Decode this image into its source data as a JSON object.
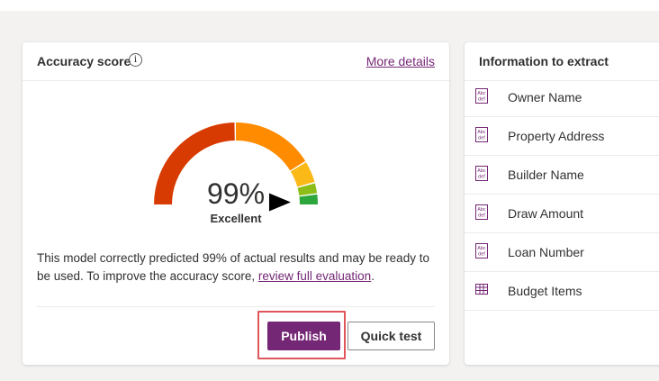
{
  "accuracy_card": {
    "title": "Accuracy score",
    "info_icon_glyph": "i",
    "more_details": "More details",
    "gauge": {
      "percent_text": "99%",
      "rating": "Excellent",
      "value": 0.99,
      "segment_colors": [
        "#d83b01",
        "#ff8c00",
        "#fbb917",
        "#8cbd18",
        "#2da63c"
      ]
    },
    "description_before": "This model correctly predicted 99% of actual results and may be ready to be used. To improve the accuracy score, ",
    "description_link": "review full evaluation",
    "description_after": ".",
    "publish_button": "Publish",
    "quick_test_button": "Quick test"
  },
  "info_card": {
    "title": "Information to extract",
    "fields": [
      {
        "label": "Owner Name",
        "icon": "text-field-icon"
      },
      {
        "label": "Property Address",
        "icon": "text-field-icon"
      },
      {
        "label": "Builder Name",
        "icon": "text-field-icon"
      },
      {
        "label": "Draw Amount",
        "icon": "text-field-icon"
      },
      {
        "label": "Loan Number",
        "icon": "text-field-icon"
      },
      {
        "label": "Budget Items",
        "icon": "table-icon"
      }
    ]
  },
  "colors": {
    "accent": "#742774",
    "highlight": "#e0565b"
  }
}
